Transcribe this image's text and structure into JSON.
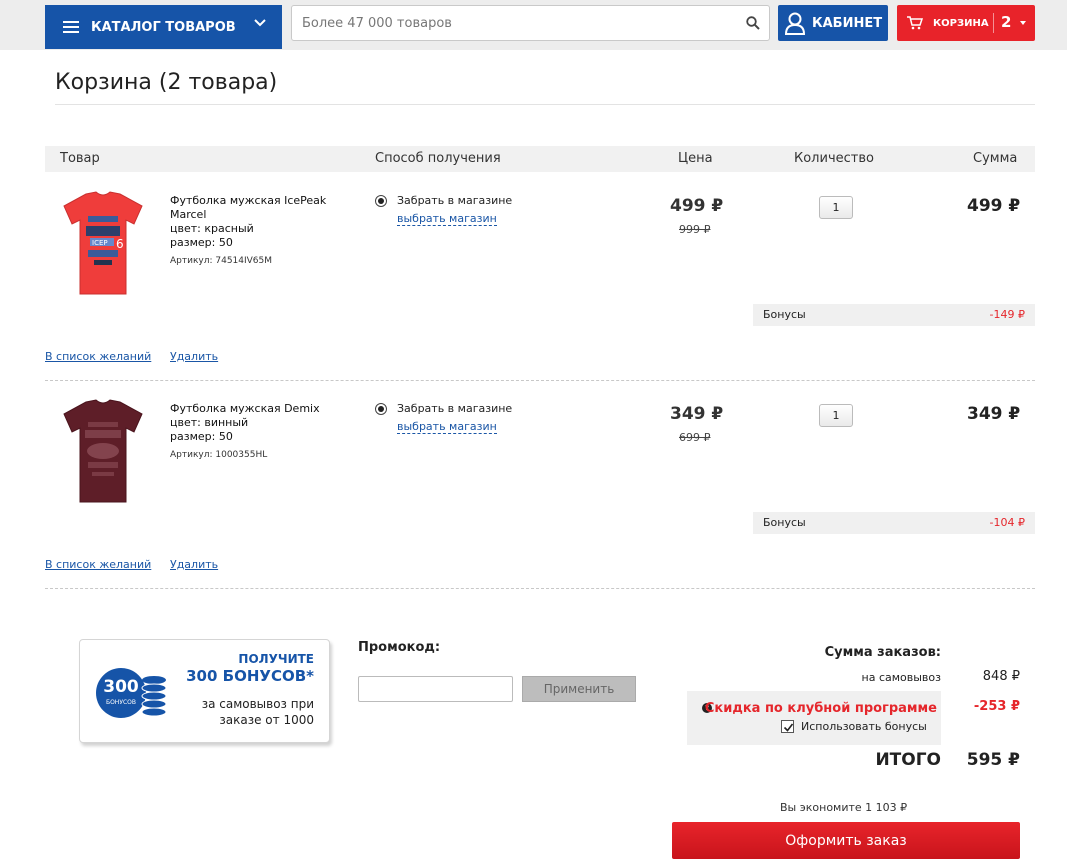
{
  "header": {
    "catalog_label": "КАТАЛОГ ТОВАРОВ",
    "search_placeholder": "Более 47 000 товаров",
    "cabinet_label": "КАБИНЕТ",
    "cart_label": "КОРЗИНА",
    "cart_count": "2"
  },
  "page_title": "Корзина (2 товара)",
  "table_headers": {
    "product": "Товар",
    "delivery": "Способ получения",
    "price": "Цена",
    "quantity": "Количество",
    "sum": "Сумма"
  },
  "items": [
    {
      "name": "Футболка мужская IcePeak Marcel",
      "color": "цвет: красный",
      "size": "размер: 50",
      "article": "Артикул: 74514IV65M",
      "pickup": "Забрать в магазине",
      "choose_store": "выбрать магазин",
      "price": "499 ₽",
      "old_price": "999 ₽",
      "quantity": "1",
      "sum": "499 ₽",
      "bonus_label": "Бонусы",
      "bonus_value": "-149 ₽",
      "wishlist": "В список желаний",
      "delete": "Удалить",
      "shirt_color": "#ee3b3b"
    },
    {
      "name": "Футболка мужская Demix",
      "color": "цвет: винный",
      "size": "размер: 50",
      "article": "Артикул: 1000355HL",
      "pickup": "Забрать в магазине",
      "choose_store": "выбрать магазин",
      "price": "349 ₽",
      "old_price": "699 ₽",
      "quantity": "1",
      "sum": "349 ₽",
      "bonus_label": "Бонусы",
      "bonus_value": "-104 ₽",
      "wishlist": "В список желаний",
      "delete": "Удалить",
      "shirt_color": "#5e1e28"
    }
  ],
  "promo_banner": {
    "coin_number": "300",
    "coin_text": "БОНУСОВ",
    "get": "ПОЛУЧИТЕ",
    "big": "300 БОНУСОВ*",
    "sub1": "за самовывоз при",
    "sub2": "заказе от 1000"
  },
  "promocode": {
    "label": "Промокод:",
    "value": "",
    "apply": "Применить"
  },
  "totals": {
    "title": "Сумма заказов:",
    "self_pickup_label": "на самовывоз",
    "self_pickup_value": "848 ₽",
    "club_discount_label": "Скидка по клубной программе",
    "club_discount_value": "-253 ₽",
    "use_bonuses_label": "Использовать бонусы",
    "use_bonuses_checked": true,
    "total_label": "ИТОГО",
    "total_value": "595 ₽",
    "economy": "Вы экономите 1 103 ₽",
    "order_button": "Оформить заказ"
  },
  "colors": {
    "brand_blue": "#1654a8",
    "brand_red": "#e8232a",
    "link_blue": "#1a56a6"
  }
}
